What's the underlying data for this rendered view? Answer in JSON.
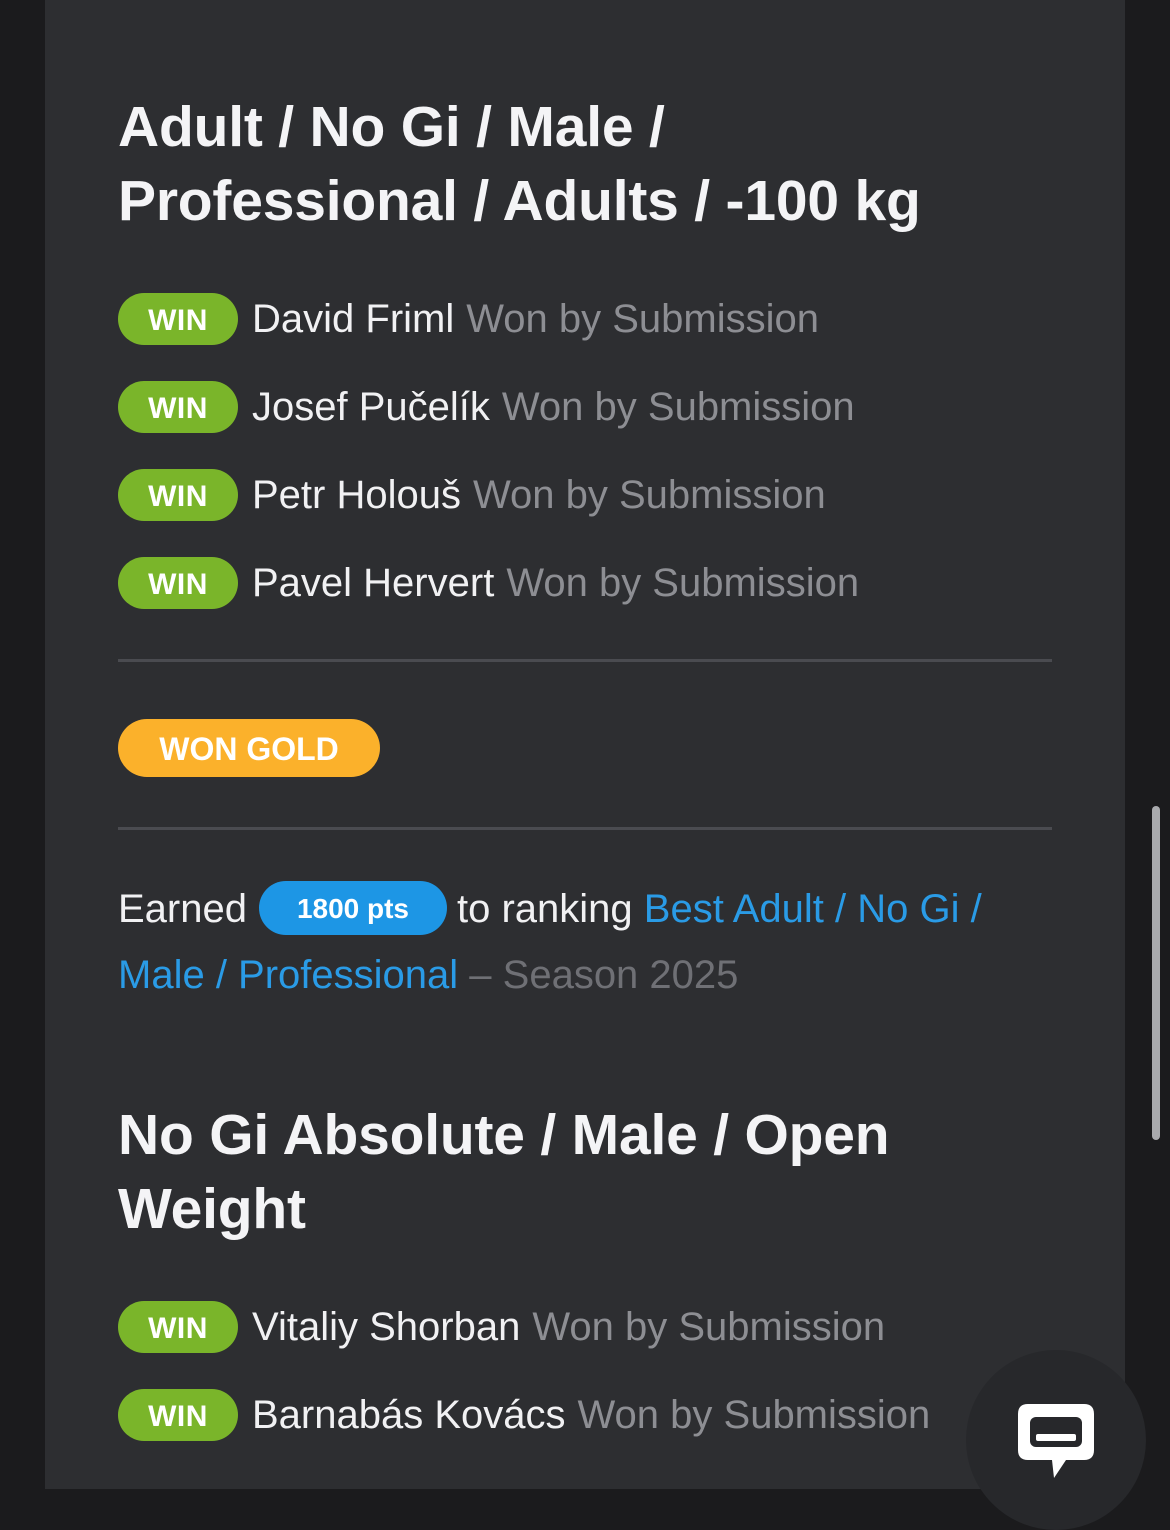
{
  "sections": [
    {
      "title_line1": "Adult / No Gi / Male /",
      "title_line2": "Professional / Adults / -100 kg",
      "matches": [
        {
          "badge": "WIN",
          "name": "David Friml",
          "result": "Won by Submission"
        },
        {
          "badge": "WIN",
          "name": "Josef Pučelík",
          "result": "Won by Submission"
        },
        {
          "badge": "WIN",
          "name": "Petr Holouš",
          "result": "Won by Submission"
        },
        {
          "badge": "WIN",
          "name": "Pavel Hervert",
          "result": "Won by Submission"
        }
      ],
      "medal": "WON GOLD",
      "earned": {
        "prefix": "Earned",
        "points": "1800 pts",
        "middle": "to ranking",
        "ranking_link": "Best Adult / No Gi / Male / Professional",
        "season": "– Season 2025"
      }
    },
    {
      "title_line1": "No Gi Absolute / Male / Open",
      "title_line2": "Weight",
      "matches": [
        {
          "badge": "WIN",
          "name": "Vitaliy Shorban",
          "result": "Won by Submission"
        },
        {
          "badge": "WIN",
          "name": "Barnabás Kovács",
          "result": "Won by Submission"
        }
      ]
    }
  ],
  "chat_widget": {
    "icon": "chat-bubble-icon"
  },
  "colors": {
    "win": "#7ab52a",
    "gold": "#fbb12b",
    "points": "#1d96e5",
    "link": "#2a9be6",
    "card_bg": "#2d2e31"
  }
}
